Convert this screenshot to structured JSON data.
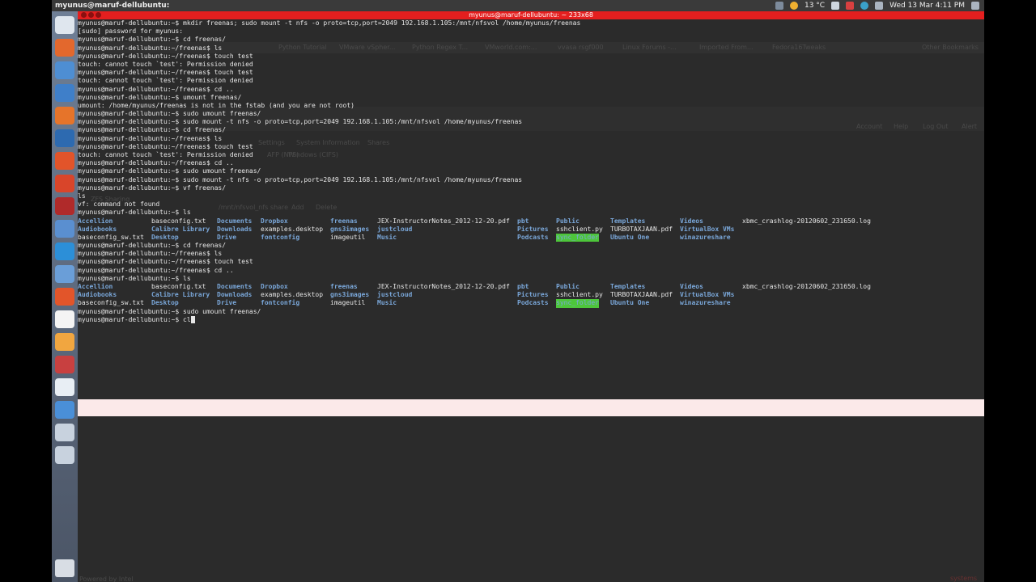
{
  "topbar": {
    "app_name": "myunus@maruf-dellubuntu:",
    "temperature": "13 °C",
    "datetime": "Wed 13 Mar  4:11 PM"
  },
  "window": {
    "title": "myunus@maruf-dellubuntu: ~ 233x68"
  },
  "launcher": {
    "icons": [
      "dash-icon",
      "files-icon",
      "chromium-icon",
      "thunderbird-icon",
      "firefox-icon",
      "vmware-icon",
      "tools-icon",
      "settings-icon",
      "terminal-icon",
      "virtualbox-icon",
      "skype-icon",
      "network-icon",
      "ubuntu-one-icon",
      "amazon-icon",
      "search-icon",
      "dictionary-icon",
      "office-icon",
      "remote-icon",
      "document-icon",
      "drive-icon"
    ]
  },
  "background_browser": {
    "bookmarks": [
      "Python Tutorial",
      "VMware vSpher...",
      "Python Regex T...",
      "VMworld.com:...",
      "vvasa rsgf000",
      "Linux Forums -...",
      "Imported From...",
      "Fedora16Tweaks",
      "Other Bookmarks"
    ],
    "toolbar": [
      "Account",
      "Help",
      "Log Out",
      "Alert"
    ],
    "tabs": [
      "Settings",
      "System Information",
      "Shares",
      "AFP (NFS)",
      "Windows (CIFS)"
    ],
    "panel": [
      "ZFS Sharing",
      "/mnt/nfsvol_nfs share",
      "Add",
      "Delete"
    ],
    "footer": "Powered by Intel",
    "watermark": "systems"
  },
  "terminal": {
    "lines_top": [
      "myunus@maruf-dellubuntu:~$ mkdir freenas; sudo mount -t nfs -o proto=tcp,port=2049 192.168.1.105:/mnt/nfsvol /home/myunus/freenas",
      "[sudo] password for myunus:",
      "myunus@maruf-dellubuntu:~$ cd freenas/",
      "myunus@maruf-dellubuntu:~/freenas$ ls",
      "myunus@maruf-dellubuntu:~/freenas$ touch test",
      "touch: cannot touch `test': Permission denied",
      "myunus@maruf-dellubuntu:~/freenas$ touch test",
      "touch: cannot touch `test': Permission denied",
      "myunus@maruf-dellubuntu:~/freenas$ cd ..",
      "myunus@maruf-dellubuntu:~$ umount freenas/",
      "umount: /home/myunus/freenas is not in the fstab (and you are not root)",
      "myunus@maruf-dellubuntu:~$ sudo umount freenas/",
      "myunus@maruf-dellubuntu:~$ sudo mount -t nfs -o proto=tcp,port=2049 192.168.1.105:/mnt/nfsvol /home/myunus/freenas",
      "myunus@maruf-dellubuntu:~$ cd freenas/",
      "myunus@maruf-dellubuntu:~/freenas$ ls",
      "myunus@maruf-dellubuntu:~/freenas$ touch test",
      "touch: cannot touch `test': Permission denied",
      "myunus@maruf-dellubuntu:~/freenas$ cd ..",
      "myunus@maruf-dellubuntu:~$ sudo umount freenas/",
      "myunus@maruf-dellubuntu:~$ sudo mount -t nfs -o proto=tcp,port=2049 192.168.1.105:/mnt/nfsvol /home/myunus/freenas",
      "myunus@maruf-dellubuntu:~$ vf freenas/",
      "ls",
      "vf: command not found",
      "myunus@maruf-dellubuntu:~$ ls"
    ],
    "lines_mid": [
      "myunus@maruf-dellubuntu:~$ cd freenas/",
      "myunus@maruf-dellubuntu:~/freenas$ ls",
      "myunus@maruf-dellubuntu:~/freenas$ touch test",
      "myunus@maruf-dellubuntu:~/freenas$ cd ..",
      "myunus@maruf-dellubuntu:~$ ls"
    ],
    "lines_bottom": [
      "myunus@maruf-dellubuntu:~$ sudo umount freenas/"
    ],
    "last_prompt": "myunus@maruf-dellubuntu:~$ ",
    "last_input": "cl",
    "listing_columns": [
      [
        {
          "t": "Accellion",
          "c": "dir"
        },
        {
          "t": "Audiobooks",
          "c": "dir"
        },
        {
          "t": "baseconfig_sw.txt",
          "c": "file"
        }
      ],
      [
        {
          "t": "baseconfig.txt",
          "c": "file"
        },
        {
          "t": "Calibre Library",
          "c": "dir"
        },
        {
          "t": "Desktop",
          "c": "dir"
        }
      ],
      [
        {
          "t": "Documents",
          "c": "dir"
        },
        {
          "t": "Downloads",
          "c": "dir"
        },
        {
          "t": "Drive",
          "c": "dir"
        }
      ],
      [
        {
          "t": "Dropbox",
          "c": "dir"
        },
        {
          "t": "examples.desktop",
          "c": "file"
        },
        {
          "t": "fontconfig",
          "c": "dir"
        }
      ],
      [
        {
          "t": "freenas",
          "c": "dir"
        },
        {
          "t": "gns3images",
          "c": "dir"
        },
        {
          "t": "imageutil",
          "c": "file"
        }
      ],
      [
        {
          "t": "JEX-InstructorNotes_2012-12-20.pdf",
          "c": "file"
        },
        {
          "t": "justcloud",
          "c": "dir"
        },
        {
          "t": "Music",
          "c": "dir"
        }
      ],
      [
        {
          "t": "pbt",
          "c": "dir"
        },
        {
          "t": "Pictures",
          "c": "dir"
        },
        {
          "t": "Podcasts",
          "c": "dir"
        }
      ],
      [
        {
          "t": "Public",
          "c": "dir"
        },
        {
          "t": "sshclient.py",
          "c": "file"
        },
        {
          "t": "sync_folder",
          "c": "hl"
        }
      ],
      [
        {
          "t": "Templates",
          "c": "dir"
        },
        {
          "t": "TURBOTAXJAAN.pdf",
          "c": "file"
        },
        {
          "t": "Ubuntu One",
          "c": "dir"
        }
      ],
      [
        {
          "t": "Videos",
          "c": "dir"
        },
        {
          "t": "VirtualBox VMs",
          "c": "dir"
        },
        {
          "t": "winazureshare",
          "c": "dir"
        }
      ],
      [
        {
          "t": "xbmc_crashlog-20120602_231650.log",
          "c": "file"
        },
        {
          "t": "",
          "c": "file"
        },
        {
          "t": "",
          "c": "file"
        }
      ]
    ]
  },
  "colors": {
    "title_bar": "#e41f1f",
    "terminal_bg": "#2b2b2b",
    "directory": "#7aa7d9",
    "highlight": "#4dc63a"
  }
}
